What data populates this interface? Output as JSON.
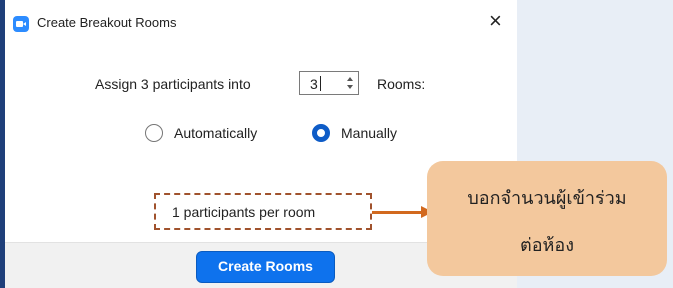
{
  "window": {
    "title": "Create Breakout Rooms",
    "close_symbol": "×",
    "icon": "zoom-camera-icon"
  },
  "assign": {
    "prefix": "Assign 3 participants into",
    "rooms_value": "3",
    "suffix": "Rooms:"
  },
  "mode": {
    "options": [
      {
        "label": "Automatically",
        "selected": false
      },
      {
        "label": "Manually",
        "selected": true
      }
    ]
  },
  "info": {
    "per_room": "1 participants per room"
  },
  "footer": {
    "create_label": "Create Rooms"
  },
  "annotation": {
    "line1": "บอกจำนวนผู้เข้าร่วม",
    "line2": "ต่อห้อง"
  },
  "colors": {
    "accent": "#0e72ed",
    "radio_selected": "#0e5cc7",
    "callout_bg": "#f3c89d",
    "callout_border": "#a0522d",
    "arrow": "#d2691e"
  }
}
